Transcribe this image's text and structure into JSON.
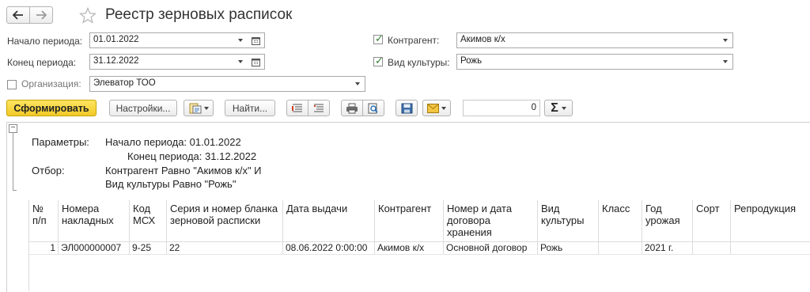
{
  "header": {
    "title": "Реестр зерновых расписок",
    "back_icon": "arrow-left",
    "forward_icon": "arrow-right",
    "favorite_icon": "star-outline"
  },
  "filters": {
    "period_start_label": "Начало периода:",
    "period_start_value": "01.01.2022",
    "period_end_label": "Конец периода:",
    "period_end_value": "31.12.2022",
    "organization_label": "Организация:",
    "organization_value": "Элеватор ТОО",
    "organization_checked": false,
    "counterparty_label": "Контрагент:",
    "counterparty_value": "Акимов к/х",
    "counterparty_checked": true,
    "crop_label": "Вид культуры:",
    "crop_value": "Рожь",
    "crop_checked": true
  },
  "toolbar": {
    "generate_label": "Сформировать",
    "settings_label": "Настройки...",
    "find_label": "Найти...",
    "sum_value": "0",
    "generate_color": "#f5d231",
    "sigma_glyph": "Σ"
  },
  "report": {
    "params_label": "Параметры:",
    "period_start_text": "Начало периода: 01.01.2022",
    "period_end_text": "Конец периода: 31.12.2022",
    "filter_label": "Отбор:",
    "filter_line1": "Контрагент Равно \"Акимов к/х\" И",
    "filter_line2": "Вид культуры Равно \"Рожь\"",
    "group_toggle": "−",
    "columns": [
      "№ п/п",
      "Номера накладных",
      "Код МСХ",
      "Серия и номер бланка зерновой расписки",
      "Дата выдачи",
      "Контрагент",
      "Номер и дата договора хранения",
      "Вид культуры",
      "Класс",
      "Год урожая",
      "Сорт",
      "Репродукция"
    ],
    "rows": [
      [
        "1",
        "ЭЛ000000007",
        "9-25",
        "22",
        "08.06.2022 0:00:00",
        "Акимов к/х",
        "Основной договор",
        "Рожь",
        "",
        "2021 г.",
        "",
        ""
      ]
    ]
  }
}
